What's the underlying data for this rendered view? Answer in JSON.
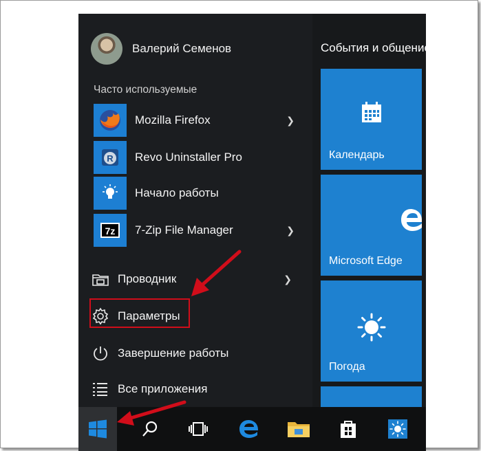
{
  "user": {
    "name": "Валерий Семенов"
  },
  "most_used_title": "Часто используемые",
  "apps": [
    {
      "label": "Mozilla Firefox",
      "icon": "firefox-icon",
      "has_submenu": true
    },
    {
      "label": "Revo Uninstaller Pro",
      "icon": "revo-uninstaller-icon",
      "has_submenu": false
    },
    {
      "label": "Начало работы",
      "icon": "lightbulb-icon",
      "has_submenu": false
    },
    {
      "label": "7-Zip File Manager",
      "icon": "7zip-icon",
      "has_submenu": true
    }
  ],
  "system": {
    "explorer": "Проводник",
    "settings": "Параметры",
    "shutdown": "Завершение работы",
    "all_apps": "Все приложения"
  },
  "tiles": {
    "group_title": "События и общение",
    "calendar": "Календарь",
    "edge": "Microsoft Edge",
    "weather": "Погода"
  },
  "taskbar": [
    "windows-start-icon",
    "search-icon",
    "task-view-icon",
    "edge-icon",
    "file-explorer-icon",
    "store-icon",
    "weather-icon"
  ],
  "colors": {
    "accent": "#1e81d0",
    "menu_bg": "#1b1d20",
    "annotation": "#d10d1a"
  }
}
